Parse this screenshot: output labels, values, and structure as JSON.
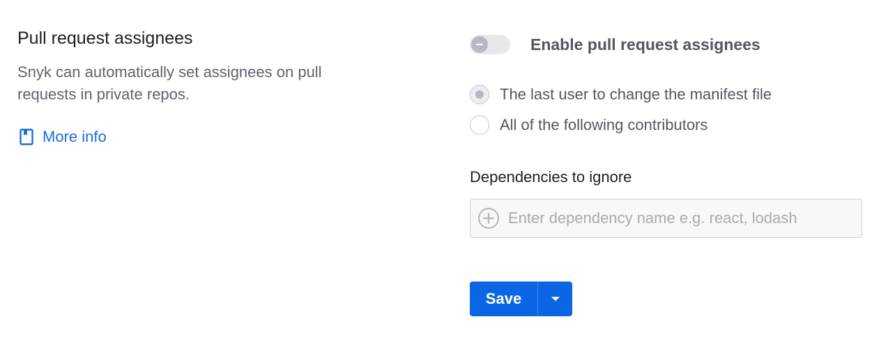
{
  "section": {
    "title": "Pull request assignees",
    "description": "Snyk can automatically set assignees on pull requests in private repos.",
    "more_info_label": "More info",
    "more_info_icon": "book-icon"
  },
  "toggle": {
    "label": "Enable pull request assignees",
    "enabled": false
  },
  "assignee_options": [
    {
      "label": "The last user to change the manifest file",
      "selected": true
    },
    {
      "label": "All of the following contributors",
      "selected": false
    }
  ],
  "dependencies": {
    "label": "Dependencies to ignore",
    "placeholder": "Enter dependency name e.g. react, lodash",
    "value": ""
  },
  "actions": {
    "save_label": "Save",
    "dropdown_icon": "caret-down-icon"
  },
  "colors": {
    "primary": "#0a66e4",
    "link": "#1a6ee0",
    "text_dark": "#1d1d26",
    "text_muted": "#61616e"
  }
}
